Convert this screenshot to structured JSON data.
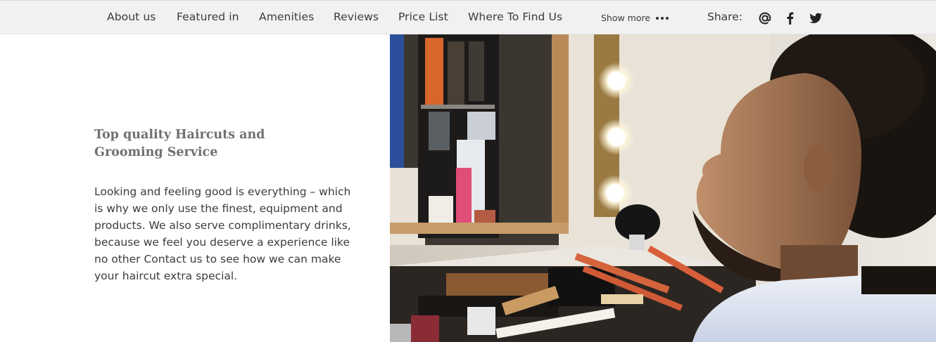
{
  "nav": {
    "items": [
      {
        "label": "About us"
      },
      {
        "label": "Featured in"
      },
      {
        "label": "Amenities"
      },
      {
        "label": "Reviews"
      },
      {
        "label": "Price List"
      },
      {
        "label": "Where To Find Us"
      }
    ],
    "show_more_label": "Show more",
    "share_label": "Share:",
    "share_icons": [
      "email-at-icon",
      "facebook-icon",
      "twitter-icon"
    ]
  },
  "content": {
    "heading": "Top quality Haircuts and Grooming Service",
    "body": "Looking and feeling good is everything – which is why we only use the finest, equipment and products. We also serve complimentary drinks, because we feel you deserve a experience like no other Contact us to see how we can make your haircut extra special."
  },
  "colors": {
    "topbar_bg": "#f1f1f1",
    "heading": "#707070",
    "text": "#3c3c3c"
  }
}
